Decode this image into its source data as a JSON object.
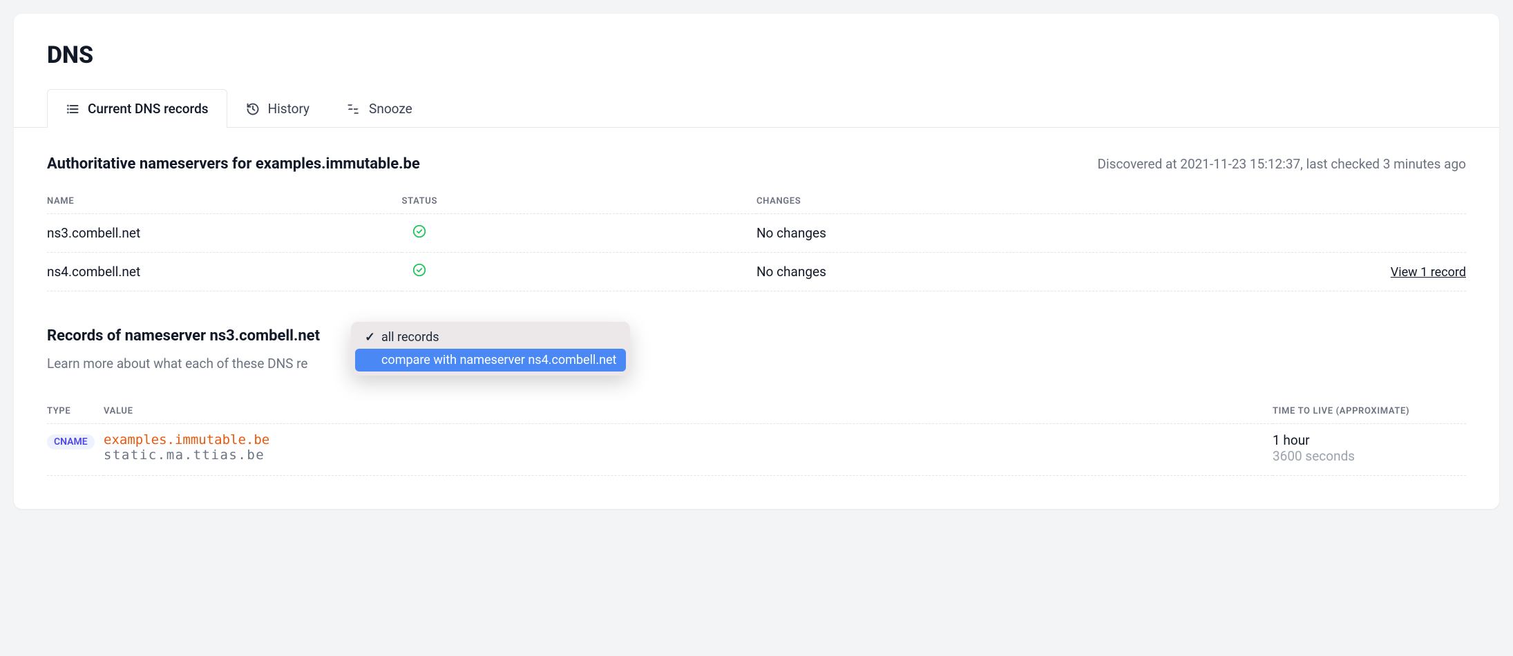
{
  "page_title": "DNS",
  "tabs": [
    {
      "label": "Current DNS records",
      "icon": "list-icon",
      "active": true
    },
    {
      "label": "History",
      "icon": "history-icon",
      "active": false
    },
    {
      "label": "Snooze",
      "icon": "snooze-icon",
      "active": false
    }
  ],
  "nameservers": {
    "title": "Authoritative nameservers for examples.immutable.be",
    "meta": "Discovered at 2021-11-23 15:12:37, last checked 3 minutes ago",
    "columns": {
      "name": "NAME",
      "status": "STATUS",
      "changes": "CHANGES"
    },
    "rows": [
      {
        "name": "ns3.combell.net",
        "status": "ok",
        "changes": "No changes",
        "action": ""
      },
      {
        "name": "ns4.combell.net",
        "status": "ok",
        "changes": "No changes",
        "action": "View 1 record"
      }
    ]
  },
  "records_section": {
    "title": "Records of nameserver ns3.combell.net",
    "subtitle_visible": "Learn more about what each of these DNS re",
    "dropdown": {
      "options": [
        {
          "label": "all records",
          "checked": true,
          "highlighted": false
        },
        {
          "label": "compare with nameserver ns4.combell.net",
          "checked": false,
          "highlighted": true
        }
      ]
    },
    "columns": {
      "type": "TYPE",
      "value": "VALUE",
      "ttl": "TIME TO LIVE (APPROXIMATE)"
    },
    "rows": [
      {
        "type": "CNAME",
        "value_main": "examples.immutable.be",
        "value_sub": "static.ma.ttias.be",
        "ttl_main": "1 hour",
        "ttl_sub": "3600 seconds"
      }
    ]
  }
}
